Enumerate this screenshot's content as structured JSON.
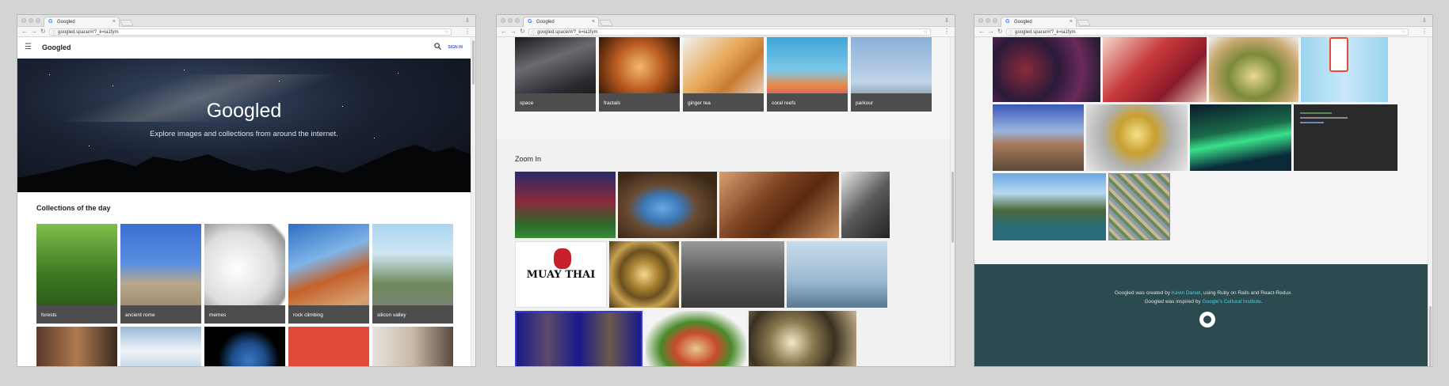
{
  "browser": {
    "tab_title": "Googled",
    "url": "googled.space/#/?_k=ia1fym"
  },
  "window1": {
    "brand": "Googled",
    "sign_in": "SIGN IN",
    "hero_title": "Googled",
    "hero_subtitle": "Explore images and collections from around the internet.",
    "collections_title": "Collections of the day",
    "collections": [
      {
        "label": "forests"
      },
      {
        "label": "ancient rome"
      },
      {
        "label": "memes"
      },
      {
        "label": "rock climbing"
      },
      {
        "label": "silicon valley"
      }
    ]
  },
  "window2": {
    "collections": [
      {
        "label": "space"
      },
      {
        "label": "fractals"
      },
      {
        "label": "ginger tea"
      },
      {
        "label": "coral reefs"
      },
      {
        "label": "parkour"
      }
    ],
    "zoom_title": "Zoom In",
    "muay_thai_text": "MUAY THAI"
  },
  "window3": {
    "footer": {
      "line1_pre": "Googled was created by ",
      "line1_link": "Kevin Daniel",
      "line1_post": ", using Ruby on Rails and React-Redux.",
      "line2_pre": "Googled was inspired by ",
      "line2_link": "Google's Cultural Institute",
      "line2_post": "."
    }
  },
  "colors": {
    "footer_bg": "#2b4b50",
    "link": "#4dd0e1",
    "sign_in": "#3d5afe",
    "label_bg": "#4d4d4d"
  }
}
